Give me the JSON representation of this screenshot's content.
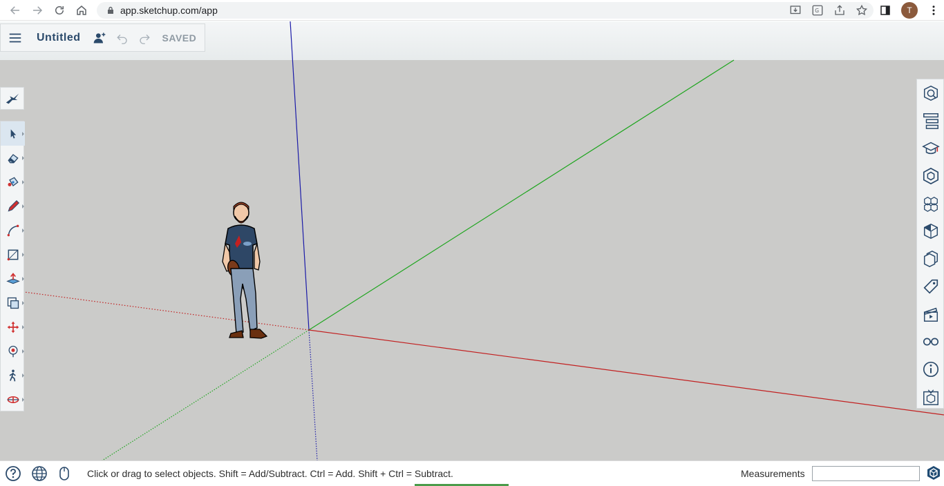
{
  "browser": {
    "url": "app.sketchup.com/app",
    "avatar_letter": "T"
  },
  "header": {
    "doc_title": "Untitled",
    "saved_label": "SAVED"
  },
  "left_toolbar": {
    "single_tool": "search-warehouse-icon",
    "tools": [
      {
        "name": "select",
        "active": true
      },
      {
        "name": "eraser",
        "active": false
      },
      {
        "name": "paint-bucket",
        "active": false
      },
      {
        "name": "pencil",
        "active": false
      },
      {
        "name": "arc",
        "active": false
      },
      {
        "name": "rectangle",
        "active": false
      },
      {
        "name": "push-pull",
        "active": false
      },
      {
        "name": "offset",
        "active": false
      },
      {
        "name": "move",
        "active": false
      },
      {
        "name": "orbit",
        "active": false
      },
      {
        "name": "walk",
        "active": false
      },
      {
        "name": "section-plane",
        "active": false
      }
    ]
  },
  "right_toolbar": {
    "panels": [
      "entity-info",
      "outliner",
      "instructor",
      "components",
      "materials-3d",
      "styles",
      "scenes-tags",
      "tags",
      "scenes",
      "display",
      "model-info",
      "solid-inspector"
    ]
  },
  "status_bar": {
    "message": "Click or drag to select objects. Shift = Add/Subtract. Ctrl = Add. Shift + Ctrl = Subtract.",
    "measurements_label": "Measurements",
    "measurements_value": ""
  },
  "colors": {
    "canvas_bg": "#cbcbc9",
    "x_axis": "#c21f1f",
    "y_axis": "#1ea51e",
    "z_axis": "#1a1aa8",
    "title_color": "#2b4a6b"
  }
}
